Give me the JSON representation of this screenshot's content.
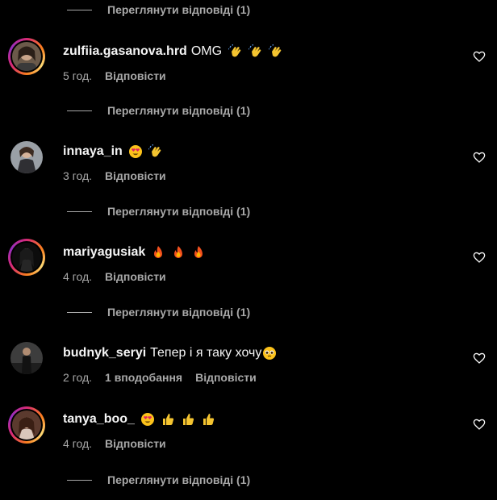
{
  "replies_label": "Переглянути відповіді (1)",
  "reply_label": "Відповісти",
  "colors": {
    "background": "#000000",
    "text": "#f5f5f5",
    "muted": "#a8a8a8",
    "ring_gradient": [
      "#d62976",
      "#fa7e1e",
      "#feda75",
      "#962fbf"
    ]
  },
  "comments": [
    {
      "username": "zulfiia.gasanova.hrd",
      "text": "OMG",
      "emojis": [
        "clapping-hands-emoji",
        "clapping-hands-emoji",
        "clapping-hands-emoji"
      ],
      "time": "5 год.",
      "likes": "",
      "story_ring": true
    },
    {
      "username": "innaya_in",
      "text": "",
      "emojis": [
        "heart-eyes-emoji",
        "clapping-hands-emoji"
      ],
      "time": "3 год.",
      "likes": "",
      "story_ring": false
    },
    {
      "username": "mariyagusiak",
      "text": "",
      "emojis": [
        "fire-emoji",
        "fire-emoji",
        "fire-emoji"
      ],
      "time": "4 год.",
      "likes": "",
      "story_ring": true
    },
    {
      "username": "budnyk_seryi",
      "text": "Тепер і я таку хочу",
      "emojis": [
        "pleading-face-emoji"
      ],
      "time": "2 год.",
      "likes": "1 вподобання",
      "story_ring": false
    },
    {
      "username": "tanya_boo_",
      "text": "",
      "emojis": [
        "heart-eyes-emoji",
        "thumbs-up-emoji",
        "thumbs-up-emoji",
        "thumbs-up-emoji"
      ],
      "time": "4 год.",
      "likes": "",
      "story_ring": true
    }
  ]
}
